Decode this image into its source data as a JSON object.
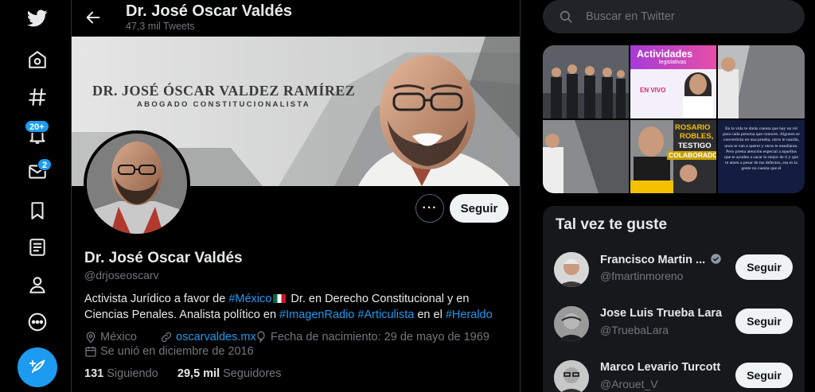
{
  "nav": {
    "items": [
      {
        "name": "twitter-logo",
        "icon": "twitter-bird-icon"
      },
      {
        "name": "nav-home",
        "icon": "home-icon"
      },
      {
        "name": "nav-explore",
        "icon": "hashtag-icon"
      },
      {
        "name": "nav-notifications",
        "icon": "bell-icon",
        "badge": "20+"
      },
      {
        "name": "nav-messages",
        "icon": "envelope-icon",
        "badge": "2"
      },
      {
        "name": "nav-bookmarks",
        "icon": "bookmark-icon"
      },
      {
        "name": "nav-lists",
        "icon": "list-icon"
      },
      {
        "name": "nav-profile",
        "icon": "person-icon"
      },
      {
        "name": "nav-more",
        "icon": "more-circle-icon"
      }
    ],
    "compose_icon": "feather-plus-icon"
  },
  "header": {
    "name": "Dr. José Oscar Valdés",
    "tweet_count": "47,3 mil Tweets"
  },
  "banner": {
    "title": "DR. JOSÉ ÓSCAR VALDEZ RAMÍREZ",
    "subtitle": "ABOGADO CONSTITUCIONALISTA"
  },
  "profile": {
    "follow_label": "Seguir",
    "more_label": "···",
    "name": "Dr. José Oscar Valdés",
    "handle": "@drjoseoscarv",
    "bio": {
      "p1": "Activista Jurídico a favor de ",
      "h1": "#México",
      "p2": " Dr. en Derecho Constitucional y en Ciencias Penales. Analista político en ",
      "h2": "#ImagenRadio",
      "p3": " ",
      "h3": "#Articulista",
      "p4": " en el ",
      "h4": "#Heraldo"
    },
    "location": "México",
    "birthday": "Fecha de nacimiento: 29 de mayo de 1969",
    "website": "oscarvaldes.mx",
    "joined": "Se unió en diciembre de 2016",
    "following_count": "131",
    "following_label": "Siguiendo",
    "followers_count": "29,5 mil",
    "followers_label": "Seguidores"
  },
  "search": {
    "placeholder": "Buscar en Twitter"
  },
  "media": {
    "tile_actividades": "Actividades",
    "tile_legislativas": "legislativas",
    "tile_envivo": "EN VIVO",
    "tile_rosario1": "ROSARIO",
    "tile_rosario2": "ROBLES,",
    "tile_rosario3": "TESTIGO",
    "tile_rosario4": "COLABORADOR",
    "tile_quote": "En la vida te darás cuenta que hay un rol para cada persona que conoces. Algunos se convertirán en una prueba, otros te usarán, unos te van a querer y otros te enseñaran. Pero presta atención especial a aquellos que te ayuden a sacar lo mejor de ti y que te amen a pesar de tus defectos, esa es la gente no cuenta que el"
  },
  "who_to_follow": {
    "title": "Tal vez te guste",
    "follow_label": "Seguir",
    "users": [
      {
        "name": "Francisco Martin ...",
        "handle": "@fmartinmoreno",
        "verified": true
      },
      {
        "name": "Jose Luis Trueba Lara",
        "handle": "@TruebaLara",
        "verified": false
      },
      {
        "name": "Marco Levario Turcott",
        "handle": "@Arouet_V",
        "verified": false
      }
    ]
  },
  "colors": {
    "accent": "#1d9bf0",
    "background": "#000000",
    "card": "#16181c",
    "muted_text": "#71767b",
    "text": "#e7e9ea"
  }
}
